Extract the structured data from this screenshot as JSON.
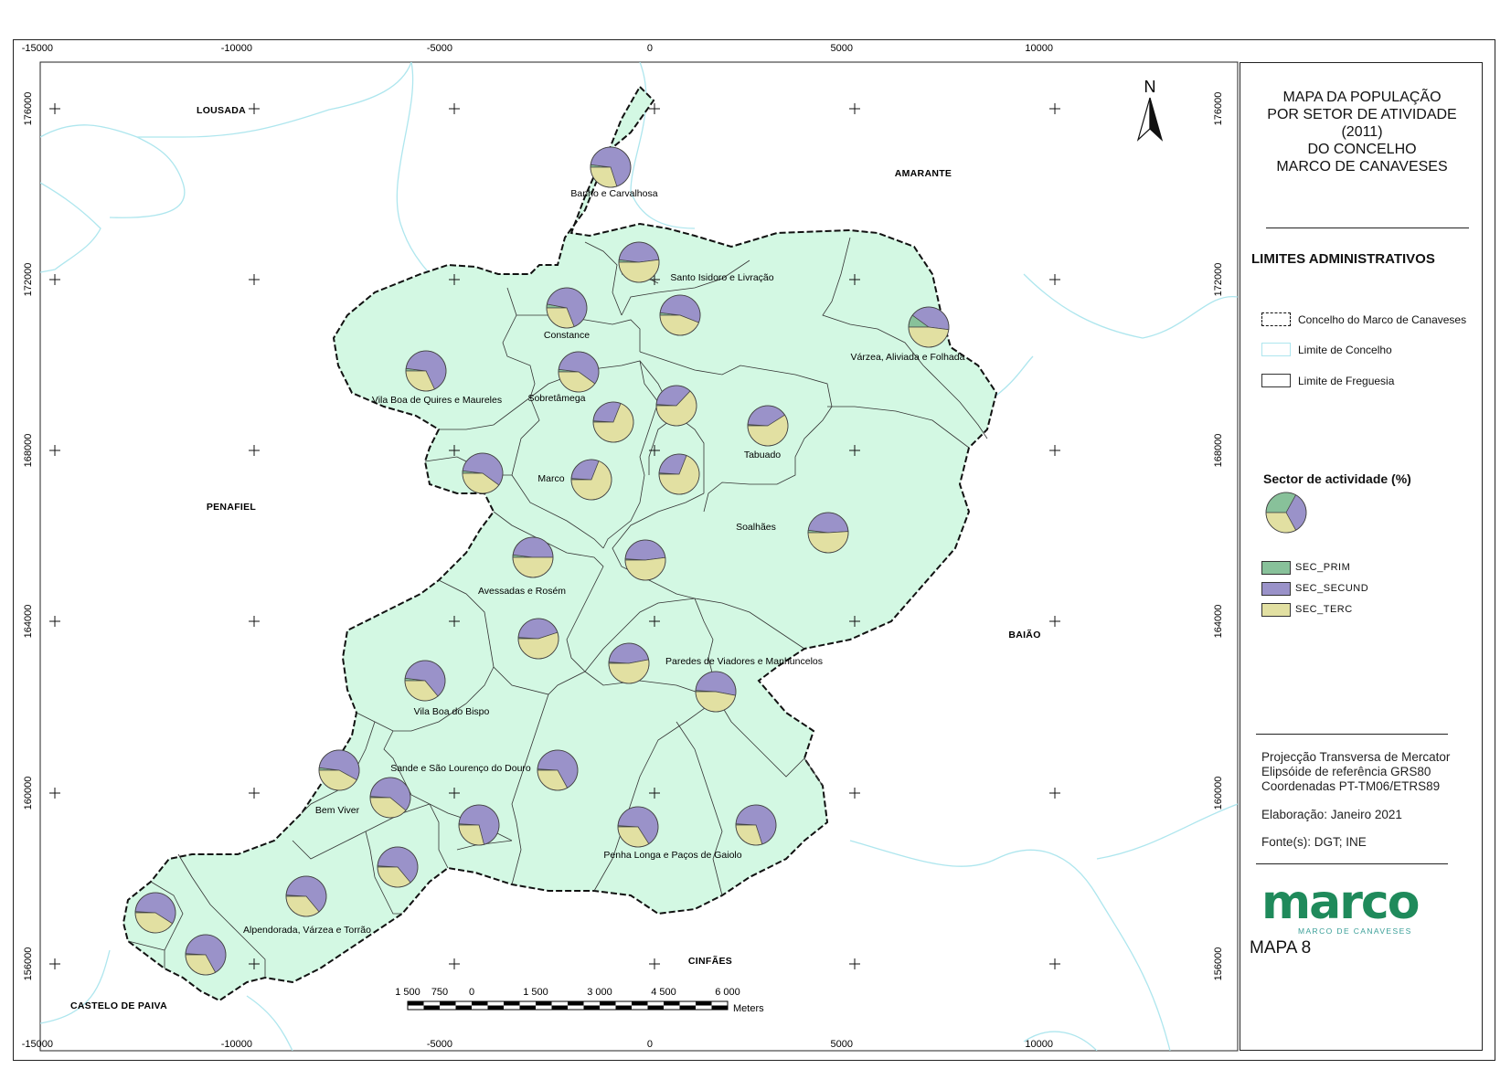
{
  "map_title": [
    "MAPA DA POPULAÇÃO",
    "POR SETOR DE ATIVIDADE",
    "(2011)",
    "DO CONCELHO",
    "MARCO DE CANAVESES"
  ],
  "north_label": "N",
  "grid": {
    "x_ticks": [
      "-15000",
      "-10000",
      "-5000",
      "0",
      "5000",
      "10000"
    ],
    "y_ticks": [
      "176000",
      "172000",
      "168000",
      "164000",
      "160000",
      "156000"
    ]
  },
  "neighbours": [
    "LOUSADA",
    "AMARANTE",
    "PENAFIEL",
    "BAIÃO",
    "CINFÃES",
    "CASTELO DE PAIVA"
  ],
  "parishes": [
    {
      "name": "Banho e Carvalhosa",
      "prim": 0.02,
      "sec": 0.68,
      "ter": 0.3
    },
    {
      "name": "Santo Isidoro e Livração",
      "prim": 0.02,
      "sec": 0.46,
      "ter": 0.52
    },
    {
      "name": "Constance",
      "prim": 0.03,
      "sec": 0.66,
      "ter": 0.31
    },
    {
      "name": "Sobretâmega",
      "prim": 0.02,
      "sec": 0.58,
      "ter": 0.4
    },
    {
      "name": "Vila Boa de Quires e Maureles",
      "prim": 0.02,
      "sec": 0.66,
      "ter": 0.32
    },
    {
      "name": "Várzea, Aliviada e Folhada",
      "prim": 0.1,
      "sec": 0.42,
      "ter": 0.48
    },
    {
      "name": "Tabuado",
      "prim": 0.01,
      "sec": 0.4,
      "ter": 0.59
    },
    {
      "name": "Marco",
      "prim": 0.01,
      "sec": 0.3,
      "ter": 0.69
    },
    {
      "name": "Soalhães",
      "prim": 0.02,
      "sec": 0.47,
      "ter": 0.51
    },
    {
      "name": "Avessadas e Rosém",
      "prim": 0.02,
      "sec": 0.48,
      "ter": 0.5
    },
    {
      "name": "Paredes de Viadores e Manhuncelos",
      "prim": 0.01,
      "sec": 0.46,
      "ter": 0.53
    },
    {
      "name": "Vila Boa do Bispo",
      "prim": 0.02,
      "sec": 0.62,
      "ter": 0.36
    },
    {
      "name": "Sande e São Lourenço do Douro",
      "prim": 0.01,
      "sec": 0.66,
      "ter": 0.33
    },
    {
      "name": "Bem Viver",
      "prim": 0.02,
      "sec": 0.56,
      "ter": 0.42
    },
    {
      "name": "Penha Longa e Paços de Gaiolo",
      "prim": 0.01,
      "sec": 0.65,
      "ter": 0.34
    },
    {
      "name": "Alpendorada, Várzea e Torrão",
      "prim": 0.01,
      "sec": 0.63,
      "ter": 0.36
    }
  ],
  "legend": {
    "admin_heading": "LIMITES ADMINISTRATIVOS",
    "concelho_marco": "Concelho do Marco de Canaveses",
    "limite_concelho": "Limite de Concelho",
    "limite_freguesia": "Limite de Freguesia",
    "sector_heading": "Sector de actividade (%)",
    "items": [
      {
        "label": "SEC_PRIM",
        "color": "#88c19a"
      },
      {
        "label": "SEC_SECUND",
        "color": "#9a92c9"
      },
      {
        "label": "SEC_TERC",
        "color": "#e2e0a2"
      }
    ]
  },
  "info": {
    "projection": [
      "Projecção Transversa de Mercator",
      "Elipsóide de referência GRS80",
      "Coordenadas PT-TM06/ETRS89"
    ],
    "elaboration": "Elaboração: Janeiro 2021",
    "sources": "Fonte(s): DGT; INE"
  },
  "logo": {
    "word": "marco",
    "sub": "MARCO DE CANAVESES",
    "color": "#1f8a5b"
  },
  "map_number": "MAPA 8",
  "scale": {
    "labels": [
      "1 500",
      "750",
      "0",
      "1 500",
      "3 000",
      "4 500",
      "6 000"
    ],
    "unit": "Meters"
  },
  "colors": {
    "municipality_fill": "#d3f8e3",
    "river": "#aee6ee",
    "slice_prim": "#88c19a",
    "slice_sec": "#9a92c9",
    "slice_ter": "#e2e0a2"
  }
}
